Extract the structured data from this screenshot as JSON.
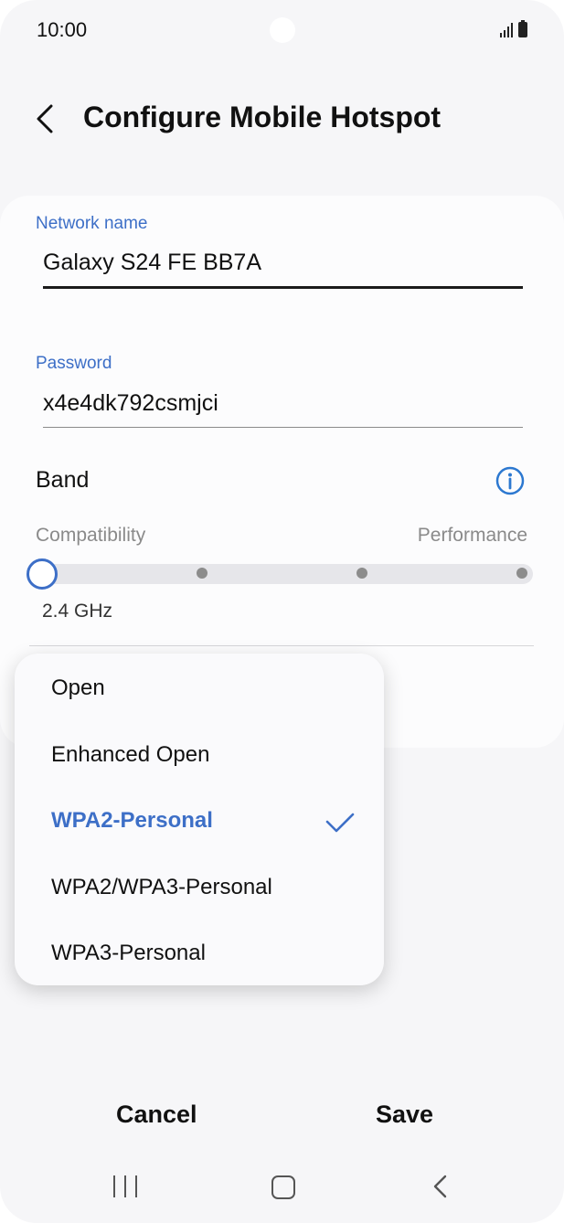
{
  "status_bar": {
    "time": "10:00"
  },
  "header": {
    "title": "Configure Mobile Hotspot"
  },
  "network": {
    "label": "Network name",
    "value": "Galaxy S24 FE BB7A"
  },
  "password": {
    "label": "Password",
    "value": "x4e4dk792csmjci"
  },
  "band": {
    "label": "Band",
    "left_label": "Compatibility",
    "right_label": "Performance",
    "value": "2.4 GHz",
    "selected_step": 1,
    "steps": 4
  },
  "security_dropdown": {
    "options": [
      "Open",
      "Enhanced Open",
      "WPA2-Personal",
      "WPA2/WPA3-Personal",
      "WPA3-Personal"
    ],
    "selected": "WPA2-Personal"
  },
  "buttons": {
    "cancel": "Cancel",
    "save": "Save"
  },
  "colors": {
    "accent": "#3d6fc7",
    "background": "#f6f6f8",
    "card": "#fcfcfd"
  },
  "icons": [
    "back-icon",
    "info-icon",
    "check-icon",
    "signal-icon",
    "battery-icon",
    "nav-recents-icon",
    "nav-home-icon",
    "nav-back-icon"
  ]
}
